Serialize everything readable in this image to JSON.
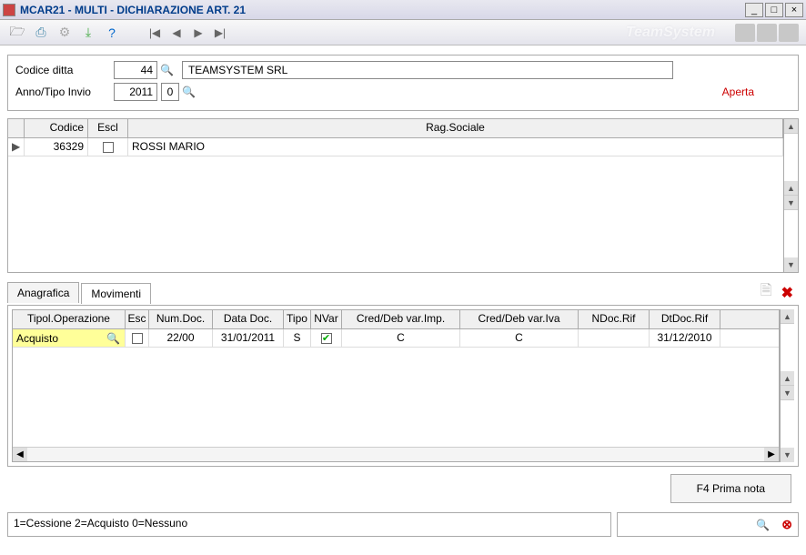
{
  "title": "MCAR21  -  MULTI -  DICHIARAZIONE ART. 21",
  "brand": "TeamSystem",
  "header": {
    "label_codice_ditta": "Codice ditta",
    "codice_ditta": "44",
    "ditta_nome": "TEAMSYSTEM SRL",
    "label_anno": "Anno/Tipo Invio",
    "anno": "2011",
    "tipo_invio": "0",
    "status": "Aperta"
  },
  "grid1": {
    "cols": {
      "codice": "Codice",
      "escl": "Escl",
      "rag": "Rag.Sociale"
    },
    "row": {
      "codice": "36329",
      "escl": false,
      "rag": "ROSSI MARIO"
    }
  },
  "tabs": {
    "anagrafica": "Anagrafica",
    "movimenti": "Movimenti"
  },
  "mov": {
    "cols": {
      "tipol": "Tipol.Operazione",
      "esc": "Esc",
      "num": "Num.Doc.",
      "data": "Data Doc.",
      "tipo": "Tipo",
      "nvar": "NVar",
      "cdimp": "Cred/Deb var.Imp.",
      "cdiva": "Cred/Deb var.Iva",
      "ndoc": "NDoc.Rif",
      "dtdoc": "DtDoc.Rif"
    },
    "row": {
      "tipol": "Acquisto",
      "esc": false,
      "num": "22/00",
      "data": "31/01/2011",
      "tipo": "S",
      "nvar": true,
      "cdimp": "C",
      "cdiva": "C",
      "ndoc": "",
      "dtdoc": "31/12/2010"
    }
  },
  "footer": {
    "prima_nota": "F4 Prima nota",
    "hint": "1=Cessione 2=Acquisto 0=Nessuno"
  }
}
